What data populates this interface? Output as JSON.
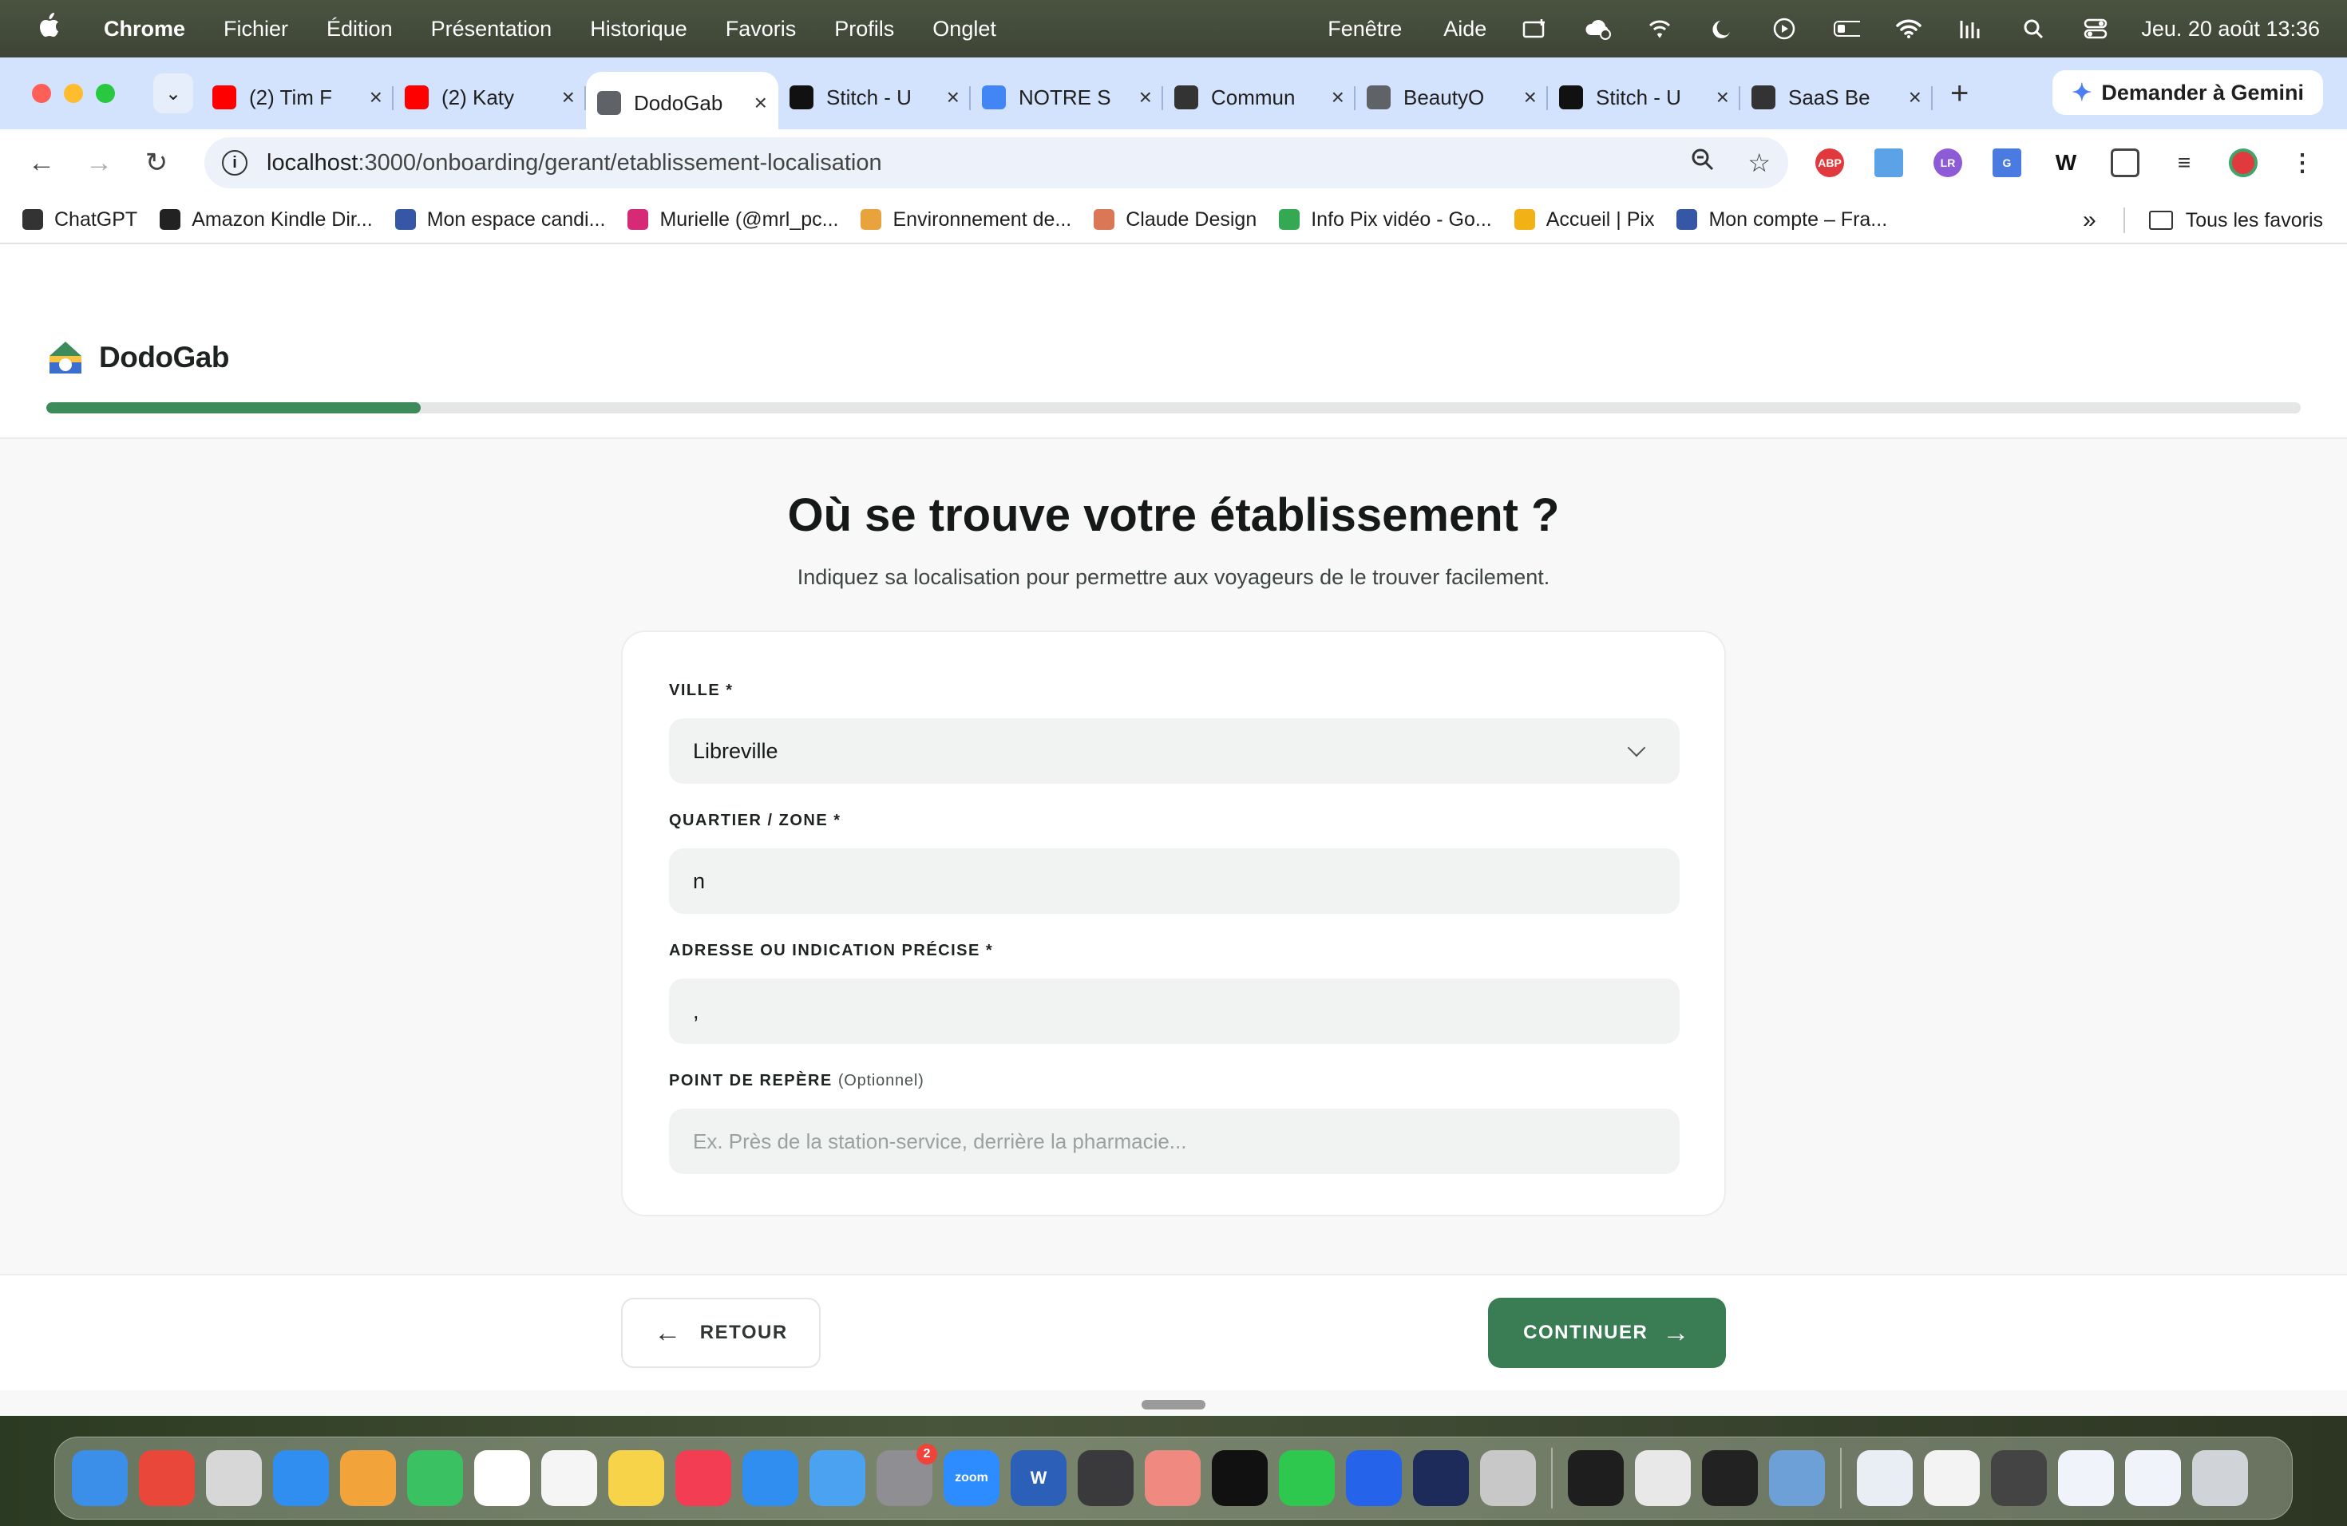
{
  "menubar": {
    "app": "Chrome",
    "menus": [
      "Fichier",
      "Édition",
      "Présentation",
      "Historique",
      "Favoris",
      "Profils",
      "Onglet"
    ],
    "right_menus": [
      "Fenêtre",
      "Aide"
    ],
    "clock": "Jeu. 20 août  13:36"
  },
  "tabs": [
    {
      "title": "(2) Tim F",
      "icon": "youtube-icon",
      "color": "#ff0000"
    },
    {
      "title": "(2) Katy ",
      "icon": "youtube-icon",
      "color": "#ff0000"
    },
    {
      "title": "DodoGab",
      "icon": "globe-icon",
      "color": "#5f6368",
      "active": true
    },
    {
      "title": "Stitch - U",
      "icon": "stitch-icon",
      "color": "#111111"
    },
    {
      "title": "NOTRE S",
      "icon": "docs-icon",
      "color": "#4285f4"
    },
    {
      "title": "Commun",
      "icon": "openai-icon",
      "color": "#333333"
    },
    {
      "title": "BeautyO",
      "icon": "globe-icon",
      "color": "#5f6368"
    },
    {
      "title": "Stitch - U",
      "icon": "stitch-icon",
      "color": "#111111"
    },
    {
      "title": "SaaS Be",
      "icon": "openai-icon",
      "color": "#333333"
    }
  ],
  "gemini_label": "Demander à Gemini",
  "address": {
    "host": "localhost",
    "path": ":3000/onboarding/gerant/etablissement-localisation"
  },
  "bookmarks": [
    {
      "label": "ChatGPT",
      "icon": "openai-icon",
      "color": "#333333"
    },
    {
      "label": "Amazon Kindle Dir...",
      "icon": "amazon-icon",
      "color": "#222222"
    },
    {
      "label": "Mon espace candi...",
      "icon": "flag-fr-icon",
      "color": "#3557a6"
    },
    {
      "label": "Murielle (@mrl_pc...",
      "icon": "instagram-icon",
      "color": "#d62976"
    },
    {
      "label": "Environnement de...",
      "icon": "cone-icon",
      "color": "#e8a33d"
    },
    {
      "label": "Claude Design",
      "icon": "claude-icon",
      "color": "#d97757"
    },
    {
      "label": "Info Pix vidéo - Go...",
      "icon": "drive-icon",
      "color": "#34a853"
    },
    {
      "label": "Accueil | Pix",
      "icon": "pix-icon",
      "color": "#f2b216"
    },
    {
      "label": "Mon compte – Fra...",
      "icon": "flag-fr-icon",
      "color": "#3557a6"
    }
  ],
  "bookmarks_all": "Tous les favoris",
  "brand": {
    "name": "DodoGab",
    "accent": "#3d8b5a"
  },
  "progress": 0.166,
  "heading": "Où se trouve votre établissement ?",
  "subheading": "Indiquez sa localisation pour permettre aux voyageurs de le trouver facilement.",
  "form": {
    "ville": {
      "label": "VILLE *",
      "value": "Libreville"
    },
    "quartier": {
      "label": "QUARTIER / ZONE *",
      "value": "n"
    },
    "adresse": {
      "label": "ADRESSE OU INDICATION PRÉCISE *",
      "value": ","
    },
    "repere": {
      "label": "POINT DE REPÈRE",
      "optional": "(Optionnel)",
      "placeholder": "Ex. Près de la station-service, derrière la pharmacie..."
    }
  },
  "buttons": {
    "back": "RETOUR",
    "next": "CONTINUER"
  },
  "dock": [
    {
      "name": "finder-icon",
      "color": "#3b8fe8"
    },
    {
      "name": "chrome-icon",
      "color": "#e9473a"
    },
    {
      "name": "launchpad-icon",
      "color": "#d7d7d7"
    },
    {
      "name": "safari-icon",
      "color": "#2f8ef0"
    },
    {
      "name": "photos-icon",
      "color": "#f2a33a"
    },
    {
      "name": "facetime-icon",
      "color": "#3ac262"
    },
    {
      "name": "calendar-icon",
      "color": "#ffffff"
    },
    {
      "name": "reminders-icon",
      "color": "#f5f5f5"
    },
    {
      "name": "notes-icon",
      "color": "#f7d34a"
    },
    {
      "name": "music-icon",
      "color": "#f33d52"
    },
    {
      "name": "appstore-icon",
      "color": "#2f8ef0"
    },
    {
      "name": "xcode-helper-icon",
      "color": "#4aa2f0"
    },
    {
      "name": "system-settings-icon",
      "color": "#8e8e93",
      "badge": "2"
    },
    {
      "name": "zoom-icon",
      "color": "#2d8cff",
      "text": "zoom"
    },
    {
      "name": "word-icon",
      "color": "#2b5fb8",
      "text": "W"
    },
    {
      "name": "calculator-icon",
      "color": "#3a3a3c"
    },
    {
      "name": "todoist-icon",
      "color": "#f08a80"
    },
    {
      "name": "capcut-icon",
      "color": "#111111"
    },
    {
      "name": "whatsapp-icon",
      "color": "#2fc84f"
    },
    {
      "name": "cursor-a-icon",
      "color": "#2563eb"
    },
    {
      "name": "affinity-icon",
      "color": "#1d2b5a"
    },
    {
      "name": "iphone-mirroring-icon",
      "color": "#c8c8c8"
    },
    {
      "name": "terminal-icon",
      "color": "#1e1e1e",
      "divider_before": true
    },
    {
      "name": "vector-icon",
      "color": "#e8e8e8"
    },
    {
      "name": "stats-icon",
      "color": "#222222"
    },
    {
      "name": "preview-icon",
      "color": "#6ea0d8"
    },
    {
      "name": "window-thumb-1-icon",
      "color": "#e9eef5",
      "divider_before": true
    },
    {
      "name": "window-thumb-2-icon",
      "color": "#f3f3f3"
    },
    {
      "name": "calculator-thumb-icon",
      "color": "#444444"
    },
    {
      "name": "window-thumb-3-icon",
      "color": "#f0f4fa"
    },
    {
      "name": "window-thumb-4-icon",
      "color": "#f0f4fa"
    },
    {
      "name": "trash-icon",
      "color": "#d0d4d8"
    }
  ]
}
